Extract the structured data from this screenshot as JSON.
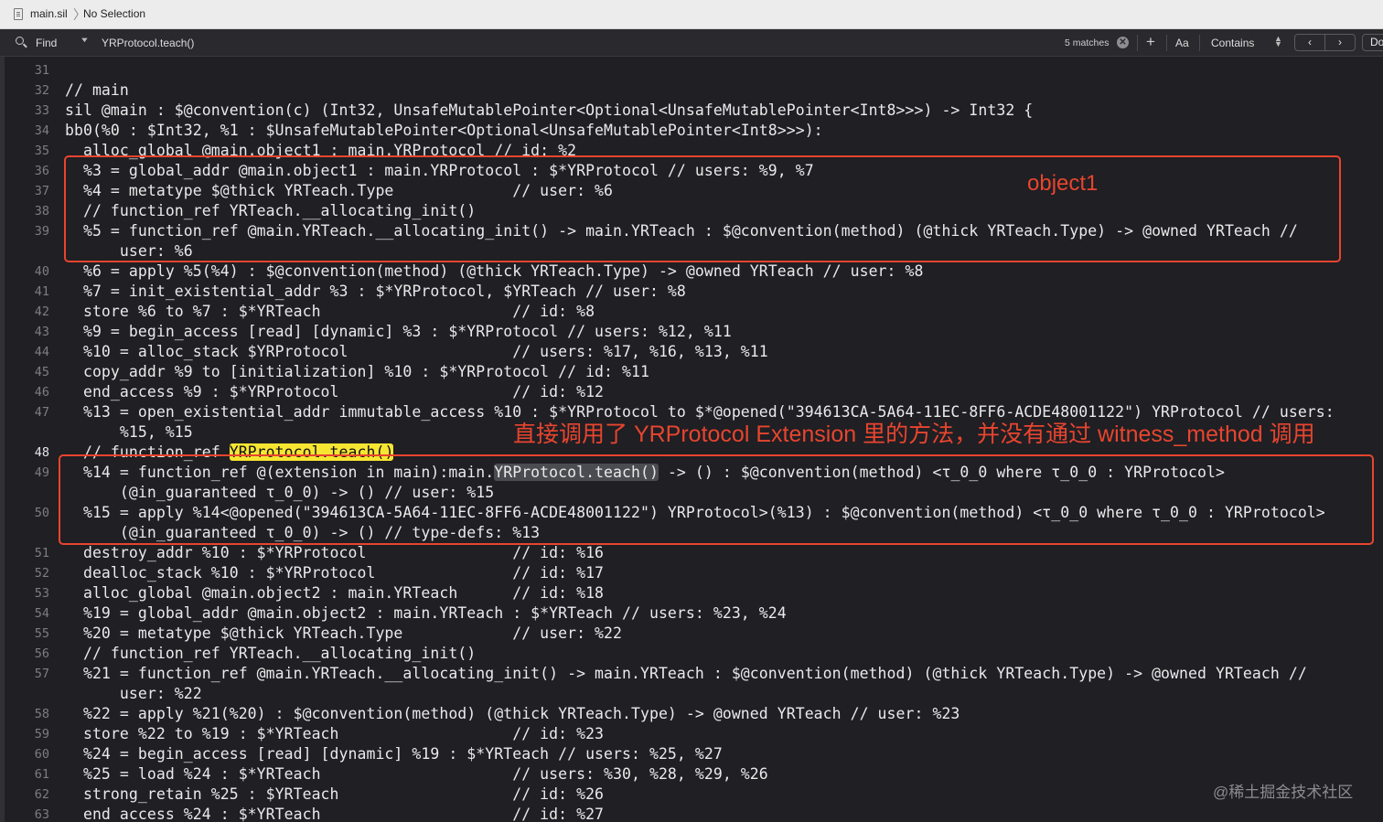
{
  "breadcrumb": {
    "file": "main.sil",
    "selection": "No Selection"
  },
  "find_bar": {
    "mode": "Find",
    "query": "YRProtocol.teach()",
    "matches": "5 matches",
    "clear": "✕",
    "add": "+",
    "case_label": "Aa",
    "match_type": "Contains",
    "prev": "‹",
    "next": "›",
    "done": "Done"
  },
  "code_lines": [
    {
      "n": "31",
      "text": ""
    },
    {
      "n": "32",
      "text": "// main"
    },
    {
      "n": "33",
      "text": "sil @main : $@convention(c) (Int32, UnsafeMutablePointer<Optional<UnsafeMutablePointer<Int8>>>) -> Int32 {"
    },
    {
      "n": "34",
      "text": "bb0(%0 : $Int32, %1 : $UnsafeMutablePointer<Optional<UnsafeMutablePointer<Int8>>>):"
    },
    {
      "n": "35",
      "text": "  alloc_global @main.object1 : main.YRProtocol // id: %2"
    },
    {
      "n": "36",
      "text": "  %3 = global_addr @main.object1 : main.YRProtocol : $*YRProtocol // users: %9, %7"
    },
    {
      "n": "37",
      "text": "  %4 = metatype $@thick YRTeach.Type             // user: %6"
    },
    {
      "n": "38",
      "text": "  // function_ref YRTeach.__allocating_init()"
    },
    {
      "n": "39",
      "text": "  %5 = function_ref @main.YRTeach.__allocating_init() -> main.YRTeach : $@convention(method) (@thick YRTeach.Type) -> @owned YRTeach //"
    },
    {
      "n": "",
      "text": "      user: %6"
    },
    {
      "n": "40",
      "text": "  %6 = apply %5(%4) : $@convention(method) (@thick YRTeach.Type) -> @owned YRTeach // user: %8"
    },
    {
      "n": "41",
      "text": "  %7 = init_existential_addr %3 : $*YRProtocol, $YRTeach // user: %8"
    },
    {
      "n": "42",
      "text": "  store %6 to %7 : $*YRTeach                     // id: %8"
    },
    {
      "n": "43",
      "text": "  %9 = begin_access [read] [dynamic] %3 : $*YRProtocol // users: %12, %11"
    },
    {
      "n": "44",
      "text": "  %10 = alloc_stack $YRProtocol                  // users: %17, %16, %13, %11"
    },
    {
      "n": "45",
      "text": "  copy_addr %9 to [initialization] %10 : $*YRProtocol // id: %11"
    },
    {
      "n": "46",
      "text": "  end_access %9 : $*YRProtocol                   // id: %12"
    },
    {
      "n": "47",
      "text": "  %13 = open_existential_addr immutable_access %10 : $*YRProtocol to $*@opened(\"394613CA-5A64-11EC-8FF6-ACDE48001122\") YRProtocol // users:"
    },
    {
      "n": "",
      "text": "      %15, %15"
    },
    {
      "n": "48",
      "text": "  // function_ref ",
      "hl": "YRProtocol.teach()",
      "after": ""
    },
    {
      "n": "49",
      "text": "  %14 = function_ref @(extension in main):main.",
      "hl2": "YRProtocol.teach()",
      "after": " -> () : $@convention(method) <τ_0_0 where τ_0_0 : YRProtocol>"
    },
    {
      "n": "",
      "text": "      (@in_guaranteed τ_0_0) -> () // user: %15"
    },
    {
      "n": "50",
      "text": "  %15 = apply %14<@opened(\"394613CA-5A64-11EC-8FF6-ACDE48001122\") YRProtocol>(%13) : $@convention(method) <τ_0_0 where τ_0_0 : YRProtocol>"
    },
    {
      "n": "",
      "text": "      (@in_guaranteed τ_0_0) -> () // type-defs: %13"
    },
    {
      "n": "51",
      "text": "  destroy_addr %10 : $*YRProtocol                // id: %16"
    },
    {
      "n": "52",
      "text": "  dealloc_stack %10 : $*YRProtocol               // id: %17"
    },
    {
      "n": "53",
      "text": "  alloc_global @main.object2 : main.YRTeach      // id: %18"
    },
    {
      "n": "54",
      "text": "  %19 = global_addr @main.object2 : main.YRTeach : $*YRTeach // users: %23, %24"
    },
    {
      "n": "55",
      "text": "  %20 = metatype $@thick YRTeach.Type            // user: %22"
    },
    {
      "n": "56",
      "text": "  // function_ref YRTeach.__allocating_init()"
    },
    {
      "n": "57",
      "text": "  %21 = function_ref @main.YRTeach.__allocating_init() -> main.YRTeach : $@convention(method) (@thick YRTeach.Type) -> @owned YRTeach //"
    },
    {
      "n": "",
      "text": "      user: %22"
    },
    {
      "n": "58",
      "text": "  %22 = apply %21(%20) : $@convention(method) (@thick YRTeach.Type) -> @owned YRTeach // user: %23"
    },
    {
      "n": "59",
      "text": "  store %22 to %19 : $*YRTeach                   // id: %23"
    },
    {
      "n": "60",
      "text": "  %24 = begin_access [read] [dynamic] %19 : $*YRTeach // users: %25, %27"
    },
    {
      "n": "61",
      "text": "  %25 = load %24 : $*YRTeach                     // users: %30, %28, %29, %26"
    },
    {
      "n": "62",
      "text": "  strong_retain %25 : $YRTeach                   // id: %26"
    },
    {
      "n": "63",
      "text": "  end_access %24 : $*YRTeach                     // id: %27"
    }
  ],
  "annotations": {
    "object1": "object1",
    "direct_call": "直接调用了 YRProtocol Extension 里的方法，并没有通过 witness_method 调用"
  },
  "colors": {
    "annotation_red": "#e8452e",
    "find_highlight": "#f6e632",
    "editor_bg": "#1f1f24"
  },
  "watermark": "@稀土掘金技术社区"
}
